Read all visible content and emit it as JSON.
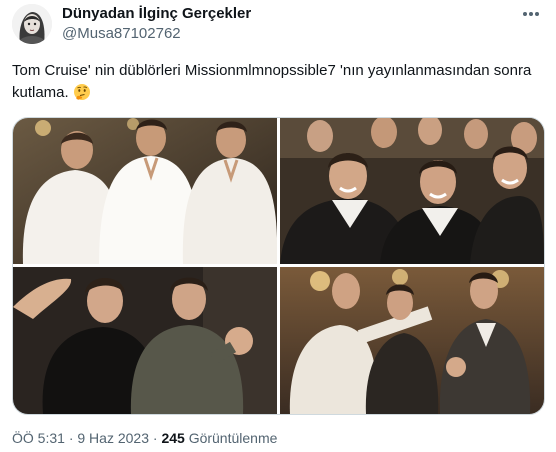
{
  "author": {
    "display_name": "Dünyadan İlginç Gerçekler",
    "handle": "@Musa87102762",
    "avatar_icon": "avatar-portrait-sketch-icon"
  },
  "menu_icon": "more-options-icon",
  "tweet": {
    "text": "Tom Cruise' nin düblörleri Missionmlmnopssible7 'nın yayınlanmasından sonra kutlama.",
    "emoji": "thinking-face"
  },
  "media": {
    "photos": [
      {
        "scene": "three men in white shirts posing together"
      },
      {
        "scene": "group of laughing men in black suits"
      },
      {
        "scene": "two men in dark shirts, one with raised fist"
      },
      {
        "scene": "men dancing in a ballroom"
      }
    ]
  },
  "meta": {
    "time": "ÖÖ 5:31",
    "sep1": "·",
    "date": "9 Haz 2023",
    "sep2": "·",
    "views_count": "245",
    "views_label": "Görüntülenme"
  },
  "colors": {
    "text_primary": "#0f1419",
    "text_secondary": "#536471",
    "border": "#cfd9de"
  }
}
